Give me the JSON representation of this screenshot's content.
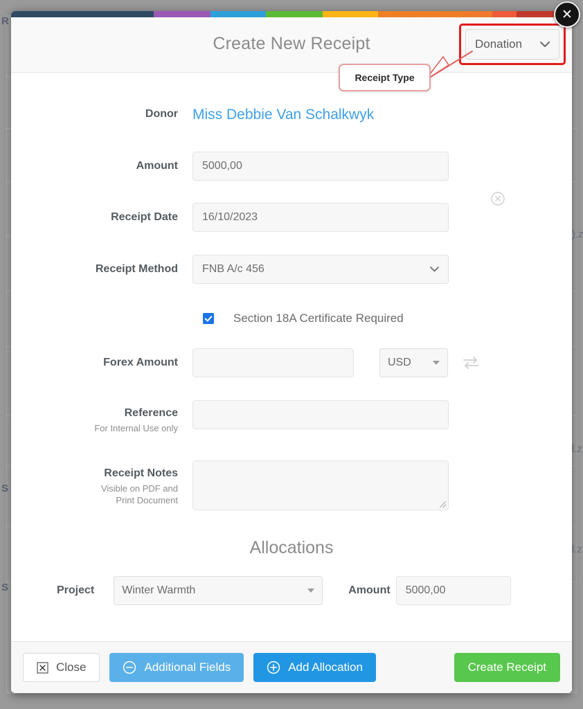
{
  "colors": {
    "bar_segments": [
      "#2f4a63",
      "#9b59b6",
      "#2e9fd9",
      "#5cbb35",
      "#fbb417",
      "#ef8022",
      "#ee5b3a",
      "#c0392b"
    ],
    "accent_blue": "#2196e3",
    "accent_light_blue": "#5ab0e8",
    "accent_green": "#58c74d",
    "donor_link": "#3fa0e8",
    "annotation_red": "#e01b1b",
    "checkbox_blue": "#1a73e8"
  },
  "window": {
    "close_button_label": "✕"
  },
  "background": {
    "left_labels": [
      "R",
      "S",
      "S"
    ],
    "right_fragments": [
      ").z",
      "l.z",
      "l.z"
    ]
  },
  "header": {
    "title": "Create New Receipt",
    "receipt_type_value": "Donation",
    "chevron": "⌄"
  },
  "annotation": {
    "callout_label": "Receipt Type"
  },
  "form": {
    "donor": {
      "label": "Donor",
      "value": "Miss Debbie Van Schalkwyk",
      "clear_icon": "clear-donor-icon"
    },
    "amount": {
      "label": "Amount",
      "value": "5000,00"
    },
    "receipt_date": {
      "label": "Receipt Date",
      "value": "16/10/2023"
    },
    "receipt_method": {
      "label": "Receipt Method",
      "value": "FNB A/c 456"
    },
    "section18a": {
      "label": "Section 18A Certificate Required",
      "checked": true
    },
    "forex": {
      "label": "Forex Amount",
      "value": "",
      "currency": "USD",
      "swap_icon": "exchange-arrows-icon"
    },
    "reference": {
      "label": "Reference",
      "sublabel": "For Internal Use only",
      "value": ""
    },
    "receipt_notes": {
      "label": "Receipt Notes",
      "sublabel": "Visible on PDF and Print Document",
      "value": ""
    }
  },
  "allocations": {
    "title": "Allocations",
    "rows": [
      {
        "project_label": "Project",
        "project_value": "Winter Warmth",
        "amount_label": "Amount",
        "amount_value": "5000,00"
      }
    ]
  },
  "footer": {
    "close_label": "Close",
    "additional_fields_label": "Additional Fields",
    "add_allocation_label": "Add Allocation",
    "create_receipt_label": "Create Receipt"
  }
}
